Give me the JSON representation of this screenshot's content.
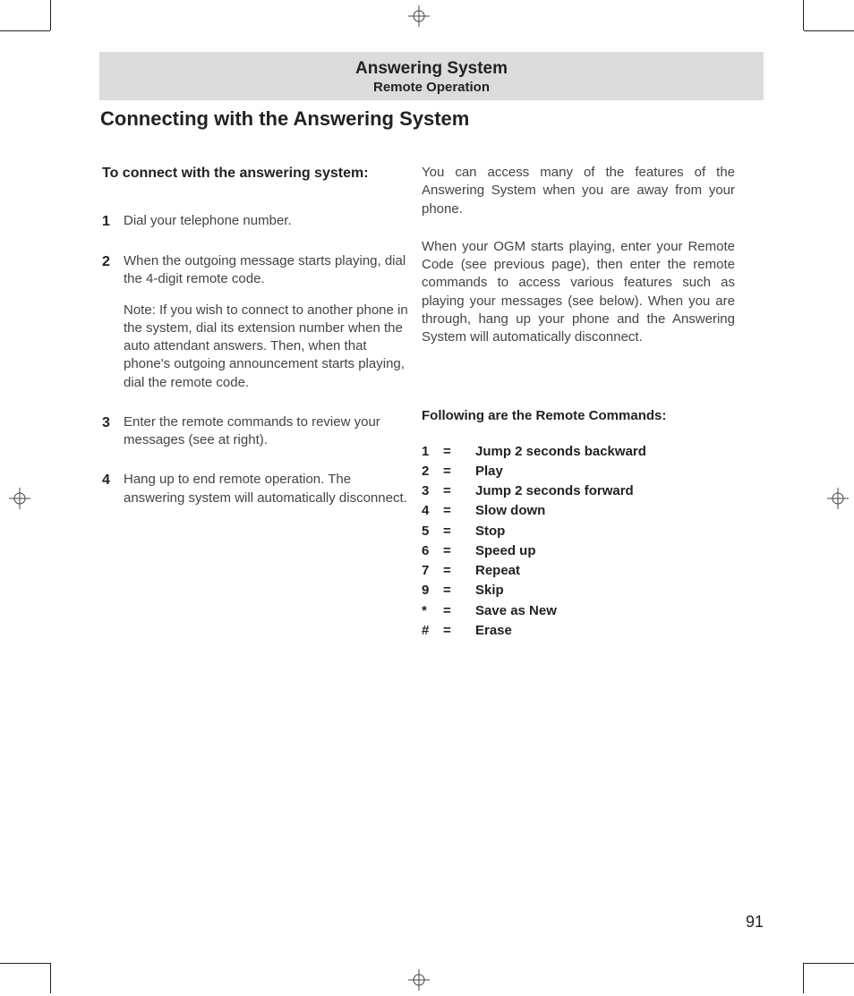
{
  "banner": {
    "title": "Answering System",
    "subtitle": "Remote Operation"
  },
  "section_title": "Connecting with the Answering System",
  "left": {
    "lead": "To connect with the answering system:",
    "steps": [
      {
        "num": "1",
        "p1": "Dial your telephone number."
      },
      {
        "num": "2",
        "p1": "When the outgoing message starts playing, dial the 4-digit remote code.",
        "p2": "Note: If you wish to connect to another phone in the system, dial its extension number when the auto attendant answers. Then, when that phone's outgoing announcement starts playing, dial the remote code."
      },
      {
        "num": "3",
        "p1": "Enter the remote commands to review your messages (see at right)."
      },
      {
        "num": "4",
        "p1": "Hang up to end remote operation. The answering system will automatically disconnect."
      }
    ]
  },
  "right": {
    "para1": "You can access many of the features of the Answering System when you are away from your phone.",
    "para2": "When your OGM starts playing, enter your Remote Code (see previous page), then enter the remote commands to access various features such as playing your messages (see below). When you are through, hang up your phone and the Answering System will automatically disconnect.",
    "remote_title": "Following are the Remote Commands:",
    "commands": [
      {
        "key": "1",
        "eq": "=",
        "desc": "Jump 2 seconds backward"
      },
      {
        "key": "2",
        "eq": "=",
        "desc": "Play"
      },
      {
        "key": "3",
        "eq": "=",
        "desc": "Jump 2 seconds forward"
      },
      {
        "key": "4",
        "eq": "=",
        "desc": "Slow down"
      },
      {
        "key": "5",
        "eq": "=",
        "desc": "Stop"
      },
      {
        "key": "6",
        "eq": "=",
        "desc": "Speed up"
      },
      {
        "key": "7",
        "eq": "=",
        "desc": "Repeat"
      },
      {
        "key": "9",
        "eq": "=",
        "desc": "Skip"
      },
      {
        "key": "*",
        "eq": "=",
        "desc": "Save as New"
      },
      {
        "key": "#",
        "eq": "=",
        "desc": "Erase"
      }
    ]
  },
  "page_number": "91"
}
